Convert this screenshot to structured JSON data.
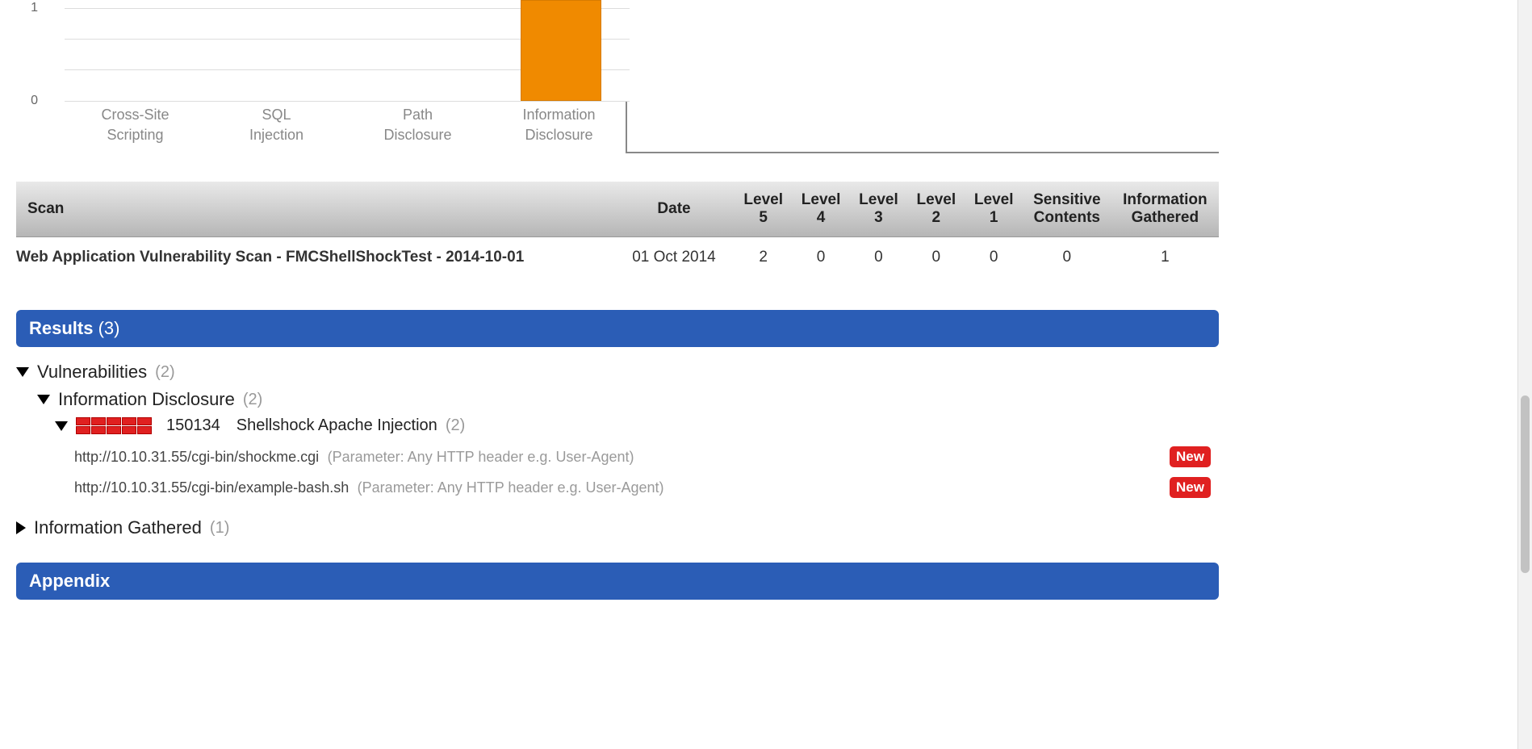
{
  "chart_data": {
    "type": "bar",
    "categories": [
      "Cross-Site Scripting",
      "SQL Injection",
      "Path Disclosure",
      "Information Disclosure"
    ],
    "values": [
      0,
      0,
      0,
      2
    ],
    "visible_y_ticks": [
      0,
      1
    ],
    "ylim_visible": [
      0,
      1.2
    ],
    "bar_color": "#f08a00",
    "title": "",
    "xlabel": "",
    "ylabel": ""
  },
  "scan_table": {
    "headers": [
      "Scan",
      "Date",
      "Level 5",
      "Level 4",
      "Level 3",
      "Level 2",
      "Level 1",
      "Sensitive Contents",
      "Information Gathered"
    ],
    "rows": [
      {
        "name": "Web Application Vulnerability Scan - FMCShellShockTest - 2014-10-01",
        "date": "01 Oct 2014",
        "level5": "2",
        "level4": "0",
        "level3": "0",
        "level2": "0",
        "level1": "0",
        "sensitive": "0",
        "info": "1"
      }
    ]
  },
  "results": {
    "title": "Results",
    "count": "(3)",
    "vulnerabilities": {
      "title": "Vulnerabilities",
      "count": "(2)",
      "info_disclosure": {
        "title": "Information Disclosure",
        "count": "(2)",
        "item": {
          "id": "150134",
          "name": "Shellshock Apache Injection",
          "count": "(2)",
          "findings": [
            {
              "url": "http://10.10.31.55/cgi-bin/shockme.cgi",
              "param": "(Parameter: Any HTTP header e.g. User-Agent)",
              "badge": "New"
            },
            {
              "url": "http://10.10.31.55/cgi-bin/example-bash.sh",
              "param": "(Parameter: Any HTTP header e.g. User-Agent)",
              "badge": "New"
            }
          ]
        }
      }
    },
    "info_gathered": {
      "title": "Information Gathered",
      "count": "(1)"
    }
  },
  "appendix": {
    "title": "Appendix"
  }
}
